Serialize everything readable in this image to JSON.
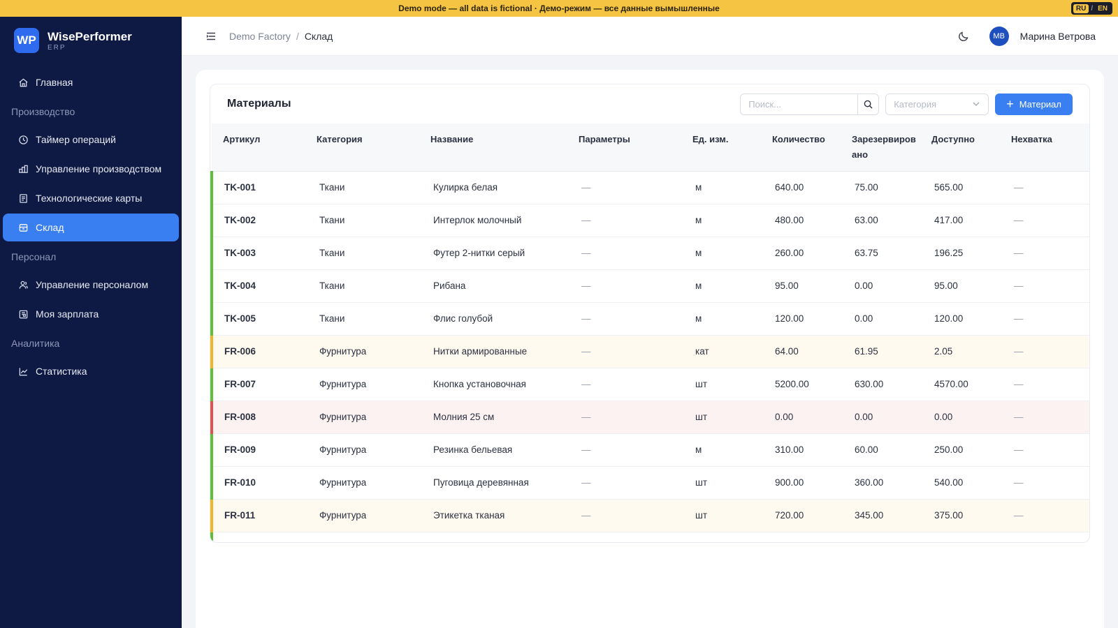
{
  "banner": {
    "text": "Demo mode — all data is fictional · Демо-режим — все данные вымышленные",
    "lang_active": "RU",
    "lang_sep": "/",
    "lang_other": "EN"
  },
  "brand": {
    "logo": "WP",
    "name": "WisePerformer",
    "sub": "ERP"
  },
  "sidebar": {
    "home": "Главная",
    "groups": {
      "production": "Производство",
      "personnel": "Персонал",
      "analytics": "Аналитика"
    },
    "items": {
      "timer": "Таймер операций",
      "production_mgmt": "Управление производством",
      "tech_cards": "Технологические карты",
      "warehouse": "Склад",
      "staff_mgmt": "Управление персоналом",
      "salary": "Моя зарплата",
      "stats": "Статистика"
    },
    "active": "warehouse"
  },
  "header": {
    "breadcrumb_parent": "Demo Factory",
    "breadcrumb_sep": "/",
    "breadcrumb_current": "Склад",
    "avatar_initials": "МВ",
    "user_name": "Марина Ветрова"
  },
  "materials": {
    "title": "Материалы",
    "search_placeholder": "Поиск...",
    "category_placeholder": "Категория",
    "add_label": "Материал",
    "columns": [
      "Артикул",
      "Категория",
      "Название",
      "Параметры",
      "Ед. изм.",
      "Количество",
      "Зарезервировано",
      "Доступно",
      "Нехватка"
    ],
    "rows": [
      {
        "sku": "TK-001",
        "category": "Ткани",
        "name": "Кулирка белая",
        "params": "—",
        "unit": "м",
        "qty": "640.00",
        "reserved": "75.00",
        "available": "565.00",
        "shortage": "—",
        "status": "ok"
      },
      {
        "sku": "TK-002",
        "category": "Ткани",
        "name": "Интерлок молочный",
        "params": "—",
        "unit": "м",
        "qty": "480.00",
        "reserved": "63.00",
        "available": "417.00",
        "shortage": "—",
        "status": "ok"
      },
      {
        "sku": "TK-003",
        "category": "Ткани",
        "name": "Футер 2-нитки серый",
        "params": "—",
        "unit": "м",
        "qty": "260.00",
        "reserved": "63.75",
        "available": "196.25",
        "shortage": "—",
        "status": "ok"
      },
      {
        "sku": "TK-004",
        "category": "Ткани",
        "name": "Рибана",
        "params": "—",
        "unit": "м",
        "qty": "95.00",
        "reserved": "0.00",
        "available": "95.00",
        "shortage": "—",
        "status": "ok"
      },
      {
        "sku": "TK-005",
        "category": "Ткани",
        "name": "Флис голубой",
        "params": "—",
        "unit": "м",
        "qty": "120.00",
        "reserved": "0.00",
        "available": "120.00",
        "shortage": "—",
        "status": "ok"
      },
      {
        "sku": "FR-006",
        "category": "Фурнитура",
        "name": "Нитки армированные",
        "params": "—",
        "unit": "кат",
        "qty": "64.00",
        "reserved": "61.95",
        "available": "2.05",
        "shortage": "—",
        "status": "warn"
      },
      {
        "sku": "FR-007",
        "category": "Фурнитура",
        "name": "Кнопка установочная",
        "params": "—",
        "unit": "шт",
        "qty": "5200.00",
        "reserved": "630.00",
        "available": "4570.00",
        "shortage": "—",
        "status": "ok"
      },
      {
        "sku": "FR-008",
        "category": "Фурнитура",
        "name": "Молния 25 см",
        "params": "—",
        "unit": "шт",
        "qty": "0.00",
        "reserved": "0.00",
        "available": "0.00",
        "shortage": "—",
        "status": "crit"
      },
      {
        "sku": "FR-009",
        "category": "Фурнитура",
        "name": "Резинка бельевая",
        "params": "—",
        "unit": "м",
        "qty": "310.00",
        "reserved": "60.00",
        "available": "250.00",
        "shortage": "—",
        "status": "ok"
      },
      {
        "sku": "FR-010",
        "category": "Фурнитура",
        "name": "Пуговица деревянная",
        "params": "—",
        "unit": "шт",
        "qty": "900.00",
        "reserved": "360.00",
        "available": "540.00",
        "shortage": "—",
        "status": "ok"
      },
      {
        "sku": "FR-011",
        "category": "Фурнитура",
        "name": "Этикетка тканая",
        "params": "—",
        "unit": "шт",
        "qty": "720.00",
        "reserved": "345.00",
        "available": "375.00",
        "shortage": "—",
        "status": "warn"
      }
    ]
  },
  "colors": {
    "accent": "#3a7ff2",
    "sidebar_bg": "#0f1a44",
    "banner_bg": "#f6c443",
    "status_ok": "#5fbf3a",
    "status_warn": "#f0b429",
    "status_crit": "#e05252"
  },
  "icons": {
    "home": "home-icon",
    "timer": "clock-icon",
    "production": "factory-icon",
    "tech_cards": "document-icon",
    "warehouse": "box-icon",
    "staff": "people-icon",
    "salary": "wallet-icon",
    "stats": "chart-icon",
    "menu": "menu-icon",
    "theme": "moon-icon",
    "search": "search-icon",
    "dropdown": "chevron-down-icon",
    "add": "plus-icon"
  }
}
